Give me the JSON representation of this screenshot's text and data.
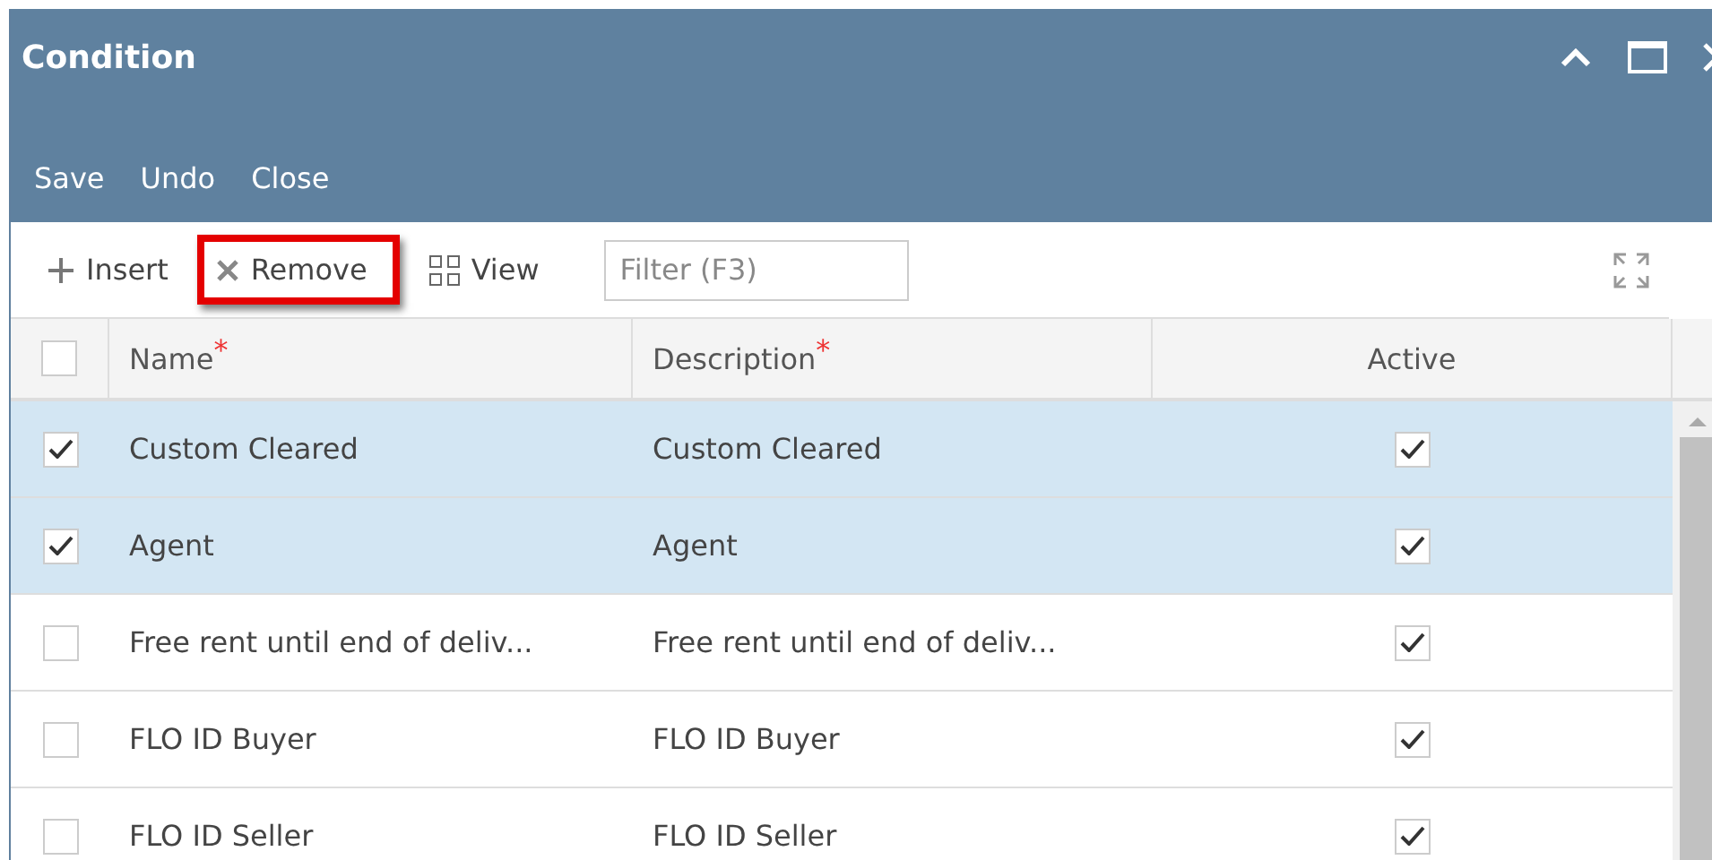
{
  "window": {
    "title": "Condition"
  },
  "menu": [
    "Save",
    "Undo",
    "Close"
  ],
  "toolbar": {
    "buttons": [
      {
        "label": "Insert",
        "kind": "insert",
        "highlighted": false
      },
      {
        "label": "Remove",
        "kind": "remove",
        "highlighted": true
      },
      {
        "label": "View",
        "kind": "view",
        "highlighted": false
      }
    ],
    "filter": {
      "placeholder": "Filter (F3)"
    }
  },
  "table": {
    "columns": [
      {
        "label": "Name",
        "required_mark": "*"
      },
      {
        "label": "Description",
        "required_mark": "*"
      },
      {
        "label": "Active"
      }
    ],
    "all_checked": false,
    "rows": [
      {
        "selected": true,
        "name": "Custom Cleared",
        "description": "Custom Cleared",
        "active": true
      },
      {
        "selected": true,
        "name": "Agent",
        "description": "Agent",
        "active": true
      },
      {
        "selected": false,
        "name": "Free rent until end of deliv...",
        "description": "Free rent until end of deliv...",
        "active": true
      },
      {
        "selected": false,
        "name": "FLO ID Buyer",
        "description": "FLO ID Buyer",
        "active": true
      },
      {
        "selected": false,
        "name": "FLO ID Seller",
        "description": "FLO ID Seller",
        "active": true
      }
    ]
  }
}
